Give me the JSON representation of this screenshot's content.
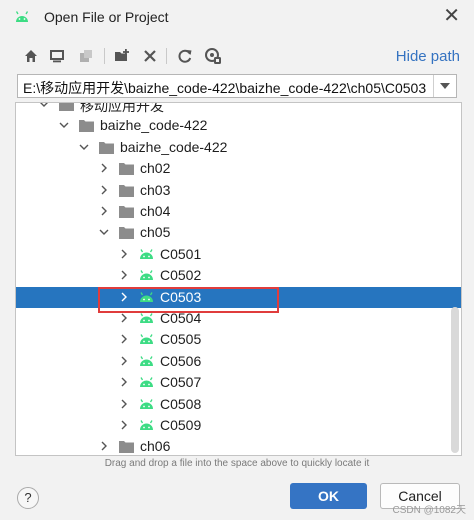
{
  "window": {
    "title": "Open File or Project",
    "close_glyph": "✕"
  },
  "toolbar": {
    "buttons": [
      "home-icon",
      "desktop-icon",
      "project-icon",
      "new-folder-icon",
      "delete-icon",
      "refresh-icon",
      "show-hidden-icon"
    ],
    "hide_path_label": "Hide path"
  },
  "path": {
    "value": "E:\\移动应用开发\\baizhe_code-422\\baizhe_code-422\\ch05\\C0503"
  },
  "tree": {
    "rows": [
      {
        "label": "移动应用开发",
        "icon": "folder-icon",
        "expanded": true
      },
      {
        "label": "baizhe_code-422",
        "icon": "folder-icon",
        "expanded": true
      },
      {
        "label": "baizhe_code-422",
        "icon": "folder-icon",
        "expanded": true
      },
      {
        "label": "ch02",
        "icon": "folder-icon",
        "expanded": false
      },
      {
        "label": "ch03",
        "icon": "folder-icon",
        "expanded": false
      },
      {
        "label": "ch04",
        "icon": "folder-icon",
        "expanded": false
      },
      {
        "label": "ch05",
        "icon": "folder-icon",
        "expanded": true
      },
      {
        "label": "C0501",
        "icon": "android-icon",
        "expanded": false
      },
      {
        "label": "C0502",
        "icon": "android-icon",
        "expanded": false
      },
      {
        "label": "C0503",
        "icon": "android-icon",
        "expanded": false,
        "selected": true
      },
      {
        "label": "C0504",
        "icon": "android-icon",
        "expanded": false
      },
      {
        "label": "C0505",
        "icon": "android-icon",
        "expanded": false
      },
      {
        "label": "C0506",
        "icon": "android-icon",
        "expanded": false
      },
      {
        "label": "C0507",
        "icon": "android-icon",
        "expanded": false
      },
      {
        "label": "C0508",
        "icon": "android-icon",
        "expanded": false
      },
      {
        "label": "C0509",
        "icon": "android-icon",
        "expanded": false
      },
      {
        "label": "ch06",
        "icon": "folder-icon",
        "expanded": false
      }
    ]
  },
  "hint": "Drag and drop a file into the space above to quickly locate it",
  "footer": {
    "help_label": "?",
    "ok_label": "OK",
    "cancel_label": "Cancel"
  },
  "watermark": "CSDN @1082天",
  "colors": {
    "accent": "#3574c4",
    "selection": "#2675bf",
    "android": "#3ddc84",
    "folder": "#8c8c8c",
    "highlight_box": "#e03c3c"
  }
}
